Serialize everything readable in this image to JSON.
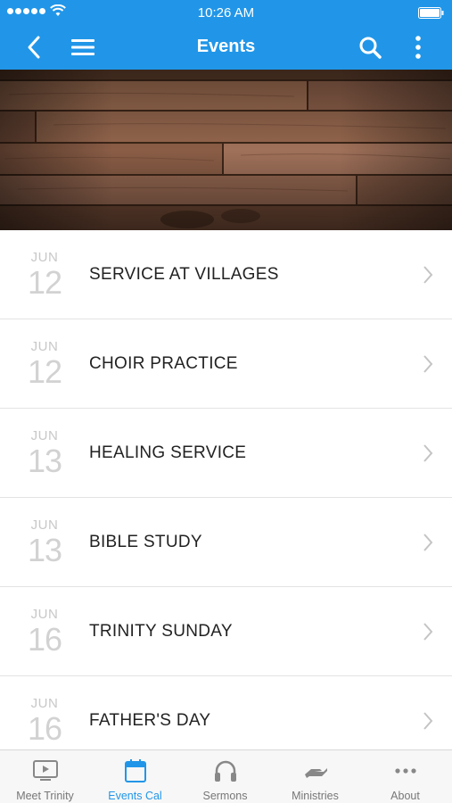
{
  "status_bar": {
    "time": "10:26 AM",
    "signal_icon": "signal-dots-icon",
    "wifi_icon": "wifi-icon",
    "battery_icon": "battery-icon"
  },
  "nav_bar": {
    "title": "Events",
    "back_icon": "back-chevron-icon",
    "menu_icon": "hamburger-menu-icon",
    "search_icon": "search-icon",
    "more_icon": "more-vertical-icon",
    "color": "#2196e8"
  },
  "banner": {
    "image": "wood-planks-banner"
  },
  "events": [
    {
      "month": "JUN",
      "day": "12",
      "title": "SERVICE AT VILLAGES"
    },
    {
      "month": "JUN",
      "day": "12",
      "title": "CHOIR PRACTICE"
    },
    {
      "month": "JUN",
      "day": "13",
      "title": "HEALING SERVICE"
    },
    {
      "month": "JUN",
      "day": "13",
      "title": "BIBLE STUDY"
    },
    {
      "month": "JUN",
      "day": "16",
      "title": "TRINITY SUNDAY"
    },
    {
      "month": "JUN",
      "day": "16",
      "title": "FATHER'S DAY"
    }
  ],
  "tab_bar": {
    "tabs": [
      {
        "label": "Meet Trinity",
        "icon": "tv-play-icon",
        "active": false
      },
      {
        "label": "Events Cal",
        "icon": "calendar-icon",
        "active": true
      },
      {
        "label": "Sermons",
        "icon": "headphones-icon",
        "active": false
      },
      {
        "label": "Ministries",
        "icon": "helping-hand-icon",
        "active": false
      },
      {
        "label": "About",
        "icon": "more-horizontal-icon",
        "active": false
      }
    ],
    "active_color": "#2196e8"
  }
}
